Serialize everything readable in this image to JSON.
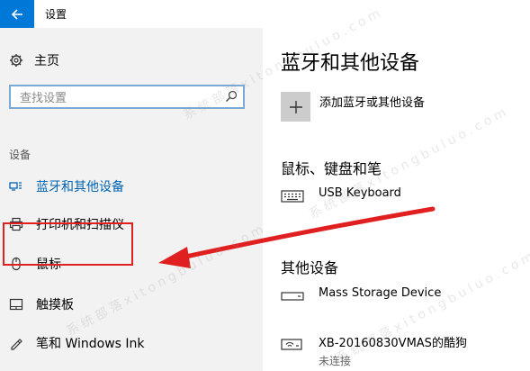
{
  "window": {
    "title": "设置"
  },
  "sidebar": {
    "home_label": "主页",
    "search_placeholder": "查找设置",
    "group_label": "设备",
    "items": [
      {
        "label": "蓝牙和其他设备",
        "icon": "bluetooth-icon",
        "active": true
      },
      {
        "label": "打印机和扫描仪",
        "icon": "printer-icon"
      },
      {
        "label": "鼠标",
        "icon": "mouse-icon",
        "highlighted": true
      },
      {
        "label": "触摸板",
        "icon": "touchpad-icon"
      },
      {
        "label": "笔和 Windows Ink",
        "icon": "pen-icon"
      }
    ]
  },
  "main": {
    "title": "蓝牙和其他设备",
    "add_label": "添加蓝牙或其他设备",
    "sections": [
      {
        "title": "鼠标、键盘和笔",
        "devices": [
          {
            "name": "USB Keyboard",
            "icon": "keyboard-icon"
          }
        ]
      },
      {
        "title": "其他设备",
        "devices": [
          {
            "name": "Mass Storage Device",
            "icon": "storage-device-icon"
          },
          {
            "name": "XB-20160830VMAS的酷狗",
            "status": "未连接",
            "icon": "network-device-icon"
          }
        ]
      }
    ]
  },
  "watermark": "系统部落xitongbuluo.com",
  "colors": {
    "accent": "#0078d7",
    "annotation": "#e02020",
    "sidebar_bg": "#f2f2f2"
  }
}
